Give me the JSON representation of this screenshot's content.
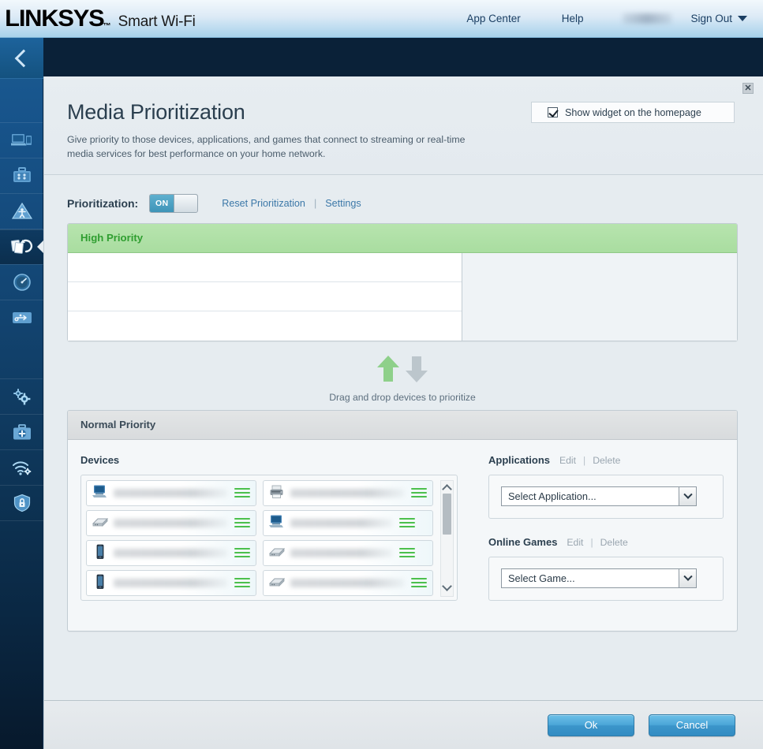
{
  "header": {
    "logo": "LINKSYS",
    "logo_tm": "™",
    "logo_sub": "Smart Wi-Fi",
    "nav": [
      {
        "label": "App Center",
        "name": "app-center"
      },
      {
        "label": "Help",
        "name": "help"
      }
    ],
    "username_redacted": "",
    "sign_out": "Sign Out"
  },
  "sidebar": {
    "back_label": "Back",
    "items": [
      {
        "name": "device-list",
        "icon": "laptop-devices-icon",
        "active": false
      },
      {
        "name": "guest-access",
        "icon": "briefcase-icon",
        "active": false
      },
      {
        "name": "parental-controls",
        "icon": "warning-triangle-icon",
        "active": false
      },
      {
        "name": "media-prioritization",
        "icon": "media-prioritization-icon",
        "active": true
      },
      {
        "name": "speed-test",
        "icon": "gauge-icon",
        "active": false
      },
      {
        "name": "external-storage",
        "icon": "usb-storage-icon",
        "active": false
      },
      {
        "name": "connectivity",
        "icon": "gears-icon",
        "active": false
      },
      {
        "name": "troubleshooting",
        "icon": "first-aid-kit-icon",
        "active": false
      },
      {
        "name": "wireless",
        "icon": "wifi-gear-icon",
        "active": false
      },
      {
        "name": "security",
        "icon": "shield-lock-icon",
        "active": false
      }
    ]
  },
  "page": {
    "title": "Media Prioritization",
    "description": "Give priority to those devices, applications, and games that connect to streaming or real-time media services for best performance on your home network.",
    "widget_checkbox_label": "Show widget on the homepage",
    "widget_checkbox_checked": true,
    "close_label": "✕"
  },
  "prioritization": {
    "label": "Prioritization:",
    "toggle_state": "ON",
    "reset_link": "Reset Prioritization",
    "separator": "|",
    "settings_link": "Settings"
  },
  "high_priority": {
    "title": "High Priority",
    "slots": [
      "",
      "",
      ""
    ],
    "slot_count": 3
  },
  "drag_hint": {
    "text": "Drag and drop devices to prioritize",
    "up_arrow_color": "#8ed08a",
    "down_arrow_color": "#b8c2c8"
  },
  "normal_priority": {
    "title": "Normal Priority",
    "devices_label": "Devices",
    "devices": [
      {
        "icon": "desktop-computer-icon",
        "name_redacted": true,
        "width": "mid"
      },
      {
        "icon": "printer-icon",
        "name_redacted": true,
        "width": "long"
      },
      {
        "icon": "network-device-icon",
        "name_redacted": true,
        "width": "mid"
      },
      {
        "icon": "desktop-computer-icon",
        "name_redacted": true,
        "width": "short"
      },
      {
        "icon": "smartphone-icon",
        "name_redacted": true,
        "width": "long"
      },
      {
        "icon": "network-device-icon",
        "name_redacted": true,
        "width": "short"
      },
      {
        "icon": "smartphone-icon",
        "name_redacted": true,
        "width": "mid"
      },
      {
        "icon": "network-device-icon",
        "name_redacted": true,
        "width": "mid"
      },
      {
        "icon": "desktop-computer-icon",
        "name_redacted": true,
        "width": "mid"
      },
      {
        "icon": "network-device-icon",
        "name_redacted": true,
        "width": "mid"
      }
    ],
    "applications": {
      "title": "Applications",
      "edit_label": "Edit",
      "separator": "|",
      "delete_label": "Delete",
      "select_value": "Select Application..."
    },
    "online_games": {
      "title": "Online Games",
      "edit_label": "Edit",
      "separator": "|",
      "delete_label": "Delete",
      "select_value": "Select Game..."
    }
  },
  "footer": {
    "ok_label": "Ok",
    "cancel_label": "Cancel"
  },
  "colors": {
    "brand_blue": "#1b5c93",
    "accent_link": "#3c78a8",
    "high_priority_green": "#a9dda0",
    "high_priority_text": "#2f9e30",
    "toggle_on": "#3e94b8",
    "button_blue": "#4ba6d8",
    "drag_handle_green": "#4cc04c"
  }
}
